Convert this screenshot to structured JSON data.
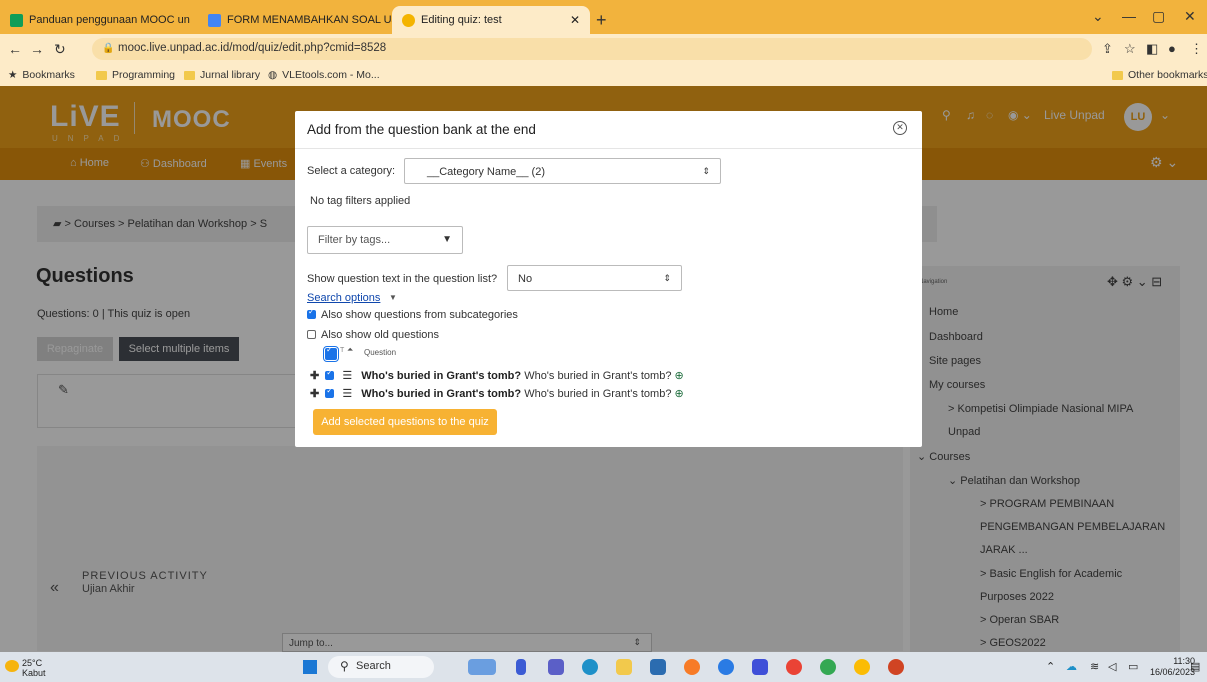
{
  "browser": {
    "tabs": [
      {
        "label": "Panduan penggunaan MOOC un",
        "color": "#0f9d58"
      },
      {
        "label": "FORM MENAMBAHKAN SOAL UJ",
        "color": "#4285f4"
      },
      {
        "label": "Editing quiz: test",
        "color": "#f4b400"
      }
    ],
    "url": "mooc.live.unpad.ac.id/mod/quiz/edit.php?cmid=8528",
    "bookmarks": [
      "Bookmarks",
      "Programming",
      "Jurnal library",
      "VLEtools.com - Mo...",
      "Other bookmarks"
    ]
  },
  "site": {
    "logo": "LiVE",
    "logo_secondary": "MOOC",
    "logo_sub": "UNPAD",
    "user_name": "Live Unpad",
    "user_initials": "LU",
    "nav": [
      "Home",
      "Dashboard",
      "Events"
    ]
  },
  "page": {
    "breadcrumb": "> Courses > Pelatihan dan Workshop > S",
    "heading": "Questions",
    "info": "Questions: 0 | This quiz is open",
    "repaginate": "Repaginate",
    "select_multiple": "Select multiple items",
    "prev_title": "PREVIOUS ACTIVITY",
    "prev_name": "Ujian Akhir",
    "jump_to": "Jump to..."
  },
  "sidebar": {
    "title": "Navigation",
    "items": [
      "Home",
      "Dashboard",
      "Site pages",
      "My courses",
      "> Kompetisi Olimpiade Nasional MIPA",
      "Unpad",
      "Courses",
      "Pelatihan dan Workshop",
      "> PROGRAM PEMBINAAN",
      "PENGEMBANGAN PEMBELAJARAN",
      "JARAK ...",
      "> Basic English for Academic",
      "Purposes 2022",
      "> Operan SBAR",
      "> GEOS2022"
    ]
  },
  "modal": {
    "title": "Add from the question bank at the end",
    "category_label": "Select a category:",
    "category_value": "__Category Name__ (2)",
    "no_tags": "No tag filters applied",
    "filter_placeholder": "Filter by tags...",
    "show_text_label": "Show question text in the question list?",
    "show_text_value": "No",
    "search_options": "Search options",
    "subcategories": "Also show questions from subcategories",
    "old_questions": "Also show old questions",
    "col_t": "T",
    "col_question": "Question",
    "questions": [
      {
        "name": "Who's buried in Grant's tomb?",
        "text": "Who's buried in Grant's tomb?"
      },
      {
        "name": "Who's buried in Grant's tomb?",
        "text": "Who's buried in Grant's tomb?"
      }
    ],
    "add_button": "Add selected questions to the quiz"
  },
  "taskbar": {
    "temp": "25°C",
    "weather": "Kabut",
    "search": "Search",
    "time": "11:30",
    "date": "16/06/2023"
  },
  "colors": {
    "brand": "#f0a21a",
    "button": "#f7b233",
    "link": "#0f47ad",
    "checkbox": "#1a73e8"
  }
}
